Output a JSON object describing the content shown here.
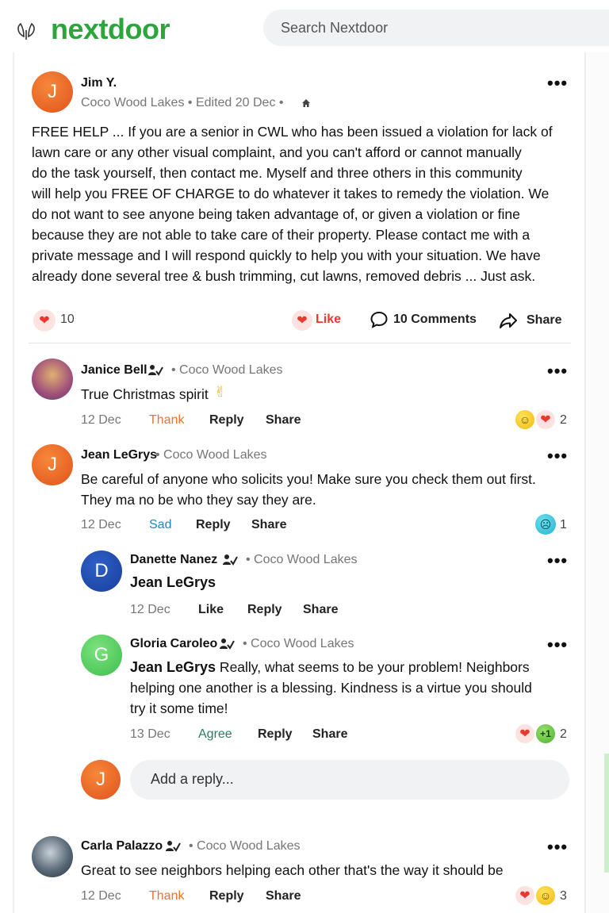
{
  "header": {
    "logo_text": "nextdoor",
    "search_placeholder": "Search Nextdoor"
  },
  "colors": {
    "brand": "#2ea43c",
    "thank": "#e8732d",
    "sad": "#1f86c2",
    "agree": "#2e7d5a",
    "like": "#e8392f"
  },
  "post": {
    "author": "Jim Y.",
    "meta": "Coco Wood Lakes • Edited 20 Dec •",
    "avatar_initial": "J",
    "body_lines": [
      "FREE HELP ... If you are a senior in CWL who has been issued a violation for lack of",
      "lawn care or any other visual complaint, and you can't afford or cannot manually",
      "do the task yourself, then contact me. Myself and three others in this community",
      "will help you FREE OF CHARGE to do whatever it takes to remedy the violation. We",
      "do not want to see anyone being taken advantage of, or given a violation or fine",
      "because they are not able to take care of their property. Please contact me with a",
      "private message and I will respond quickly to help you with your situation. We have",
      "already done several tree & bush trimming, cut lawns, removed debris ... Just ask."
    ],
    "reaction_count": "10",
    "like_label": "Like",
    "comments_label": "10 Comments",
    "share_label": "Share"
  },
  "comments": [
    {
      "author": "Janice Bell",
      "neighborhood": "• Coco Wood Lakes",
      "text": "True Christmas spirit",
      "date": "12 Dec",
      "reaction_label": "Thank",
      "reply_label": "Reply",
      "share_label": "Share",
      "reaction_count": "2"
    },
    {
      "author": "Jean LeGrys",
      "neighborhood": "• Coco Wood Lakes",
      "avatar_initial": "J",
      "text_lines": [
        "Be careful of anyone who solicits you! Make sure you check them out first.",
        "They ma no be who they say they are."
      ],
      "date": "12 Dec",
      "reaction_label": "Sad",
      "reply_label": "Reply",
      "share_label": "Share",
      "reaction_count": "1"
    },
    {
      "author": "Danette Nanez",
      "neighborhood": "• Coco Wood Lakes",
      "avatar_initial": "D",
      "mention": "Jean LeGrys",
      "date": "12 Dec",
      "reaction_label": "Like",
      "reply_label": "Reply",
      "share_label": "Share"
    },
    {
      "author": "Gloria Caroleo",
      "neighborhood": "• Coco Wood Lakes",
      "avatar_initial": "G",
      "mention": "Jean LeGrys",
      "text_lines": [
        " Really, what seems to be your problem!  Neighbors",
        "helping one another is a blessing.  Kindness is a virtue you should",
        "try it some time!"
      ],
      "date": "13 Dec",
      "reaction_label": "Agree",
      "reply_label": "Reply",
      "share_label": "Share",
      "reaction_count": "2"
    },
    {
      "author": "Carla Palazzo",
      "neighborhood": "• Coco Wood Lakes",
      "text": "Great to see neighbors helping each other that's the way it should be",
      "date": "12 Dec",
      "reaction_label": "Thank",
      "reply_label": "Reply",
      "share_label": "Share",
      "reaction_count": "3"
    }
  ],
  "reply_box": {
    "avatar_initial": "J",
    "placeholder": "Add a reply..."
  },
  "more_glyph": "•••",
  "plus_one": "+1"
}
